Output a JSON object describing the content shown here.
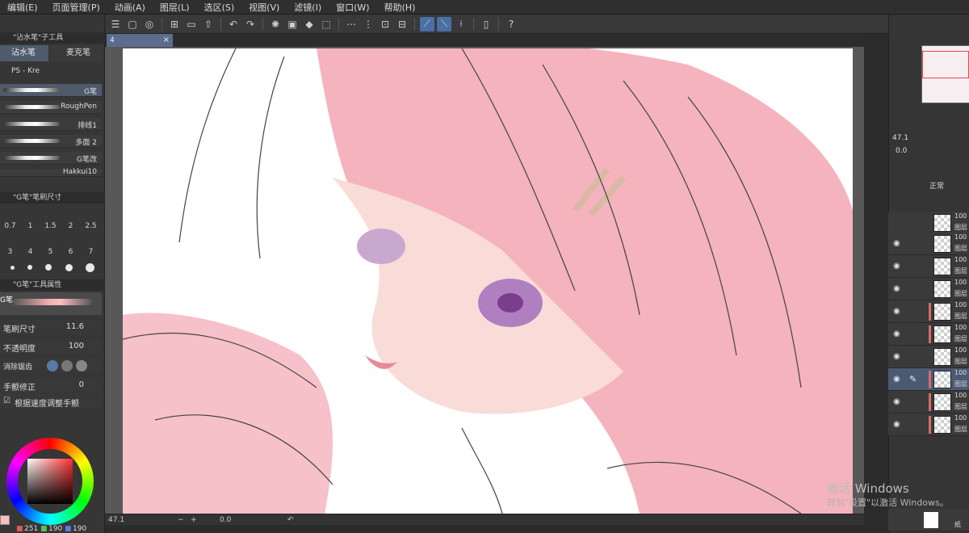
{
  "menubar": {
    "items": [
      "编辑(E)",
      "页面管理(P)",
      "动画(A)",
      "图层(L)",
      "选区(S)",
      "视图(V)",
      "滤镜(I)",
      "窗口(W)",
      "帮助(H)"
    ]
  },
  "toolbar": {
    "icons": [
      "menu-icon",
      "new-icon",
      "save-icon",
      "undo-icon",
      "redo-icon",
      "select-all-icon",
      "fill-icon",
      "transform-icon",
      "snap-icon",
      "ruler-icon",
      "phone-icon",
      "help-icon"
    ]
  },
  "sub_tool": {
    "title": "\"沾水笔\"子工具",
    "tabs": [
      "沾水笔",
      "麦克笔"
    ],
    "group": "PS - Kre",
    "brushes": [
      "G笔",
      "RoughPen",
      "排线1",
      "多面 2",
      "G笔改",
      "Hakkui10"
    ]
  },
  "brush_size": {
    "title": "\"G笔\"笔刷尺寸",
    "row1": [
      "0.7",
      "1",
      "1.5",
      "2",
      "2.5"
    ],
    "row2": [
      "3",
      "4",
      "5",
      "6",
      "7"
    ]
  },
  "tool_property": {
    "title": "\"G笔\"工具属性",
    "preview_label": "G笔",
    "brush_size_label": "笔刷尺寸",
    "brush_size_value": "11.6",
    "opacity_label": "不透明度",
    "opacity_value": "100",
    "antialias_label": "消除锯齿",
    "stabilizer_label": "手颤修正",
    "stabilizer_value": "0",
    "speed_label": "根据速度调整手颤"
  },
  "color": {
    "r": "251",
    "g": "190",
    "b": "190",
    "main": "#fbbebe"
  },
  "document": {
    "tab": "4"
  },
  "status": {
    "zoom": "47.1",
    "angle": "0.0"
  },
  "navigator": {
    "zoom": "47.1",
    "angle": "0.0"
  },
  "layer_panel": {
    "blend_mode": "正常",
    "layers": [
      {
        "pct": "100",
        "name": "图层"
      },
      {
        "pct": "100",
        "name": "图层"
      },
      {
        "pct": "100",
        "name": "图层"
      },
      {
        "pct": "100",
        "name": "图层"
      },
      {
        "pct": "100",
        "name": "图层"
      },
      {
        "pct": "100",
        "name": "图层"
      },
      {
        "pct": "100",
        "name": "图层"
      },
      {
        "pct": "100",
        "name": "图层"
      },
      {
        "pct": "100",
        "name": "图层"
      },
      {
        "pct": "100",
        "name": "图层"
      }
    ],
    "last_label": "纸"
  },
  "watermark": {
    "line1": "激活 Windows",
    "line2": "转到\"设置\"以激活 Windows。"
  }
}
